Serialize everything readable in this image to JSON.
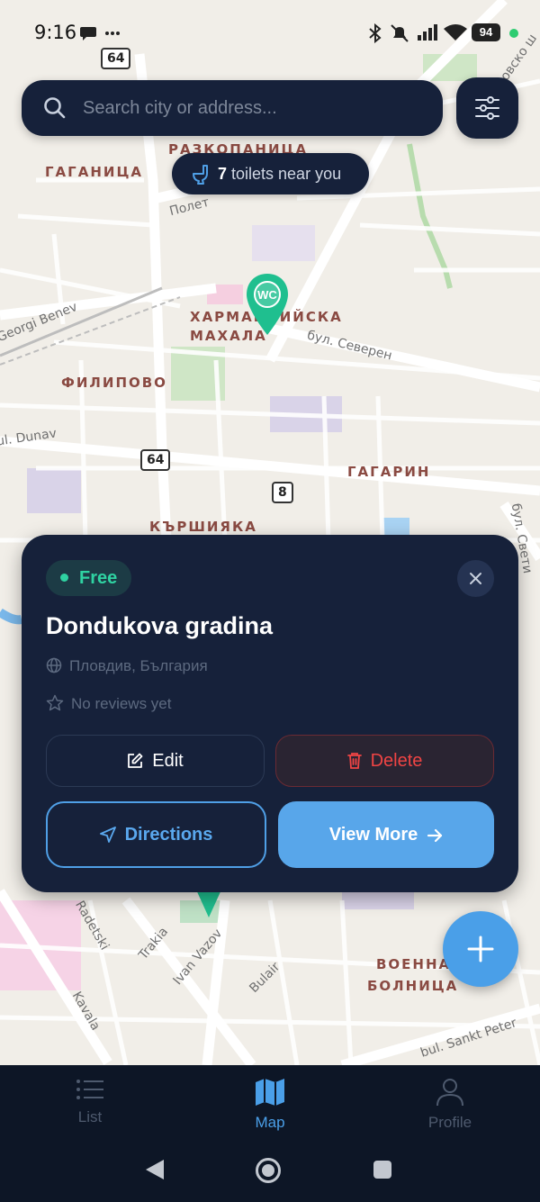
{
  "status_bar": {
    "time": "9:16",
    "battery": "94"
  },
  "search": {
    "placeholder": "Search city or address..."
  },
  "toilet_count": {
    "number": "7",
    "text": " toilets near you"
  },
  "map": {
    "district_labels": [
      "РАЗКОПАНИЦА",
      "ГАГАНИЦА",
      "ХАРМАНЛИЙСКА",
      "МАХАЛА",
      "ФИЛИПОВО",
      "ГАГАРИН",
      "КЪРШИЯКА",
      "ВОЕННА",
      "БОЛНИЦА"
    ],
    "street_labels": [
      "Полет",
      "Georgi Benev",
      "бул. Северен",
      "ul. Dunav",
      "бул. Свети",
      "Radetski",
      "Trakia",
      "Ivan Vazov",
      "Bulair",
      "Kavala",
      "bul. Sankt Peter",
      "Брезовско ш"
    ],
    "road_shields": [
      "64",
      "64",
      "8"
    ],
    "marker_label": "WC"
  },
  "detail_card": {
    "badge": "Free",
    "title": "Dondukova gradina",
    "location": "Пловдив, България",
    "reviews": "No reviews yet",
    "edit_label": "Edit",
    "delete_label": "Delete",
    "directions_label": "Directions",
    "view_more_label": "View More"
  },
  "bottom_nav": {
    "items": [
      {
        "label": "List"
      },
      {
        "label": "Map"
      },
      {
        "label": "Profile"
      }
    ]
  },
  "colors": {
    "panel": "#16213a",
    "accent": "#4a9fe8",
    "free_green": "#2fd3a2",
    "delete_red": "#ef4444",
    "marker_green": "#1fbf8f"
  }
}
